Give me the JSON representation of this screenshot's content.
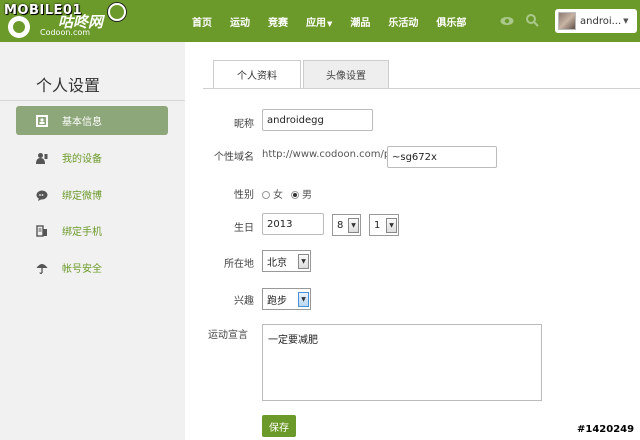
{
  "header": {
    "watermark_brand": "MOBILE01",
    "brand_cn": "咕咚网",
    "brand_en": "Codoon.com",
    "nav": [
      {
        "label": "首页"
      },
      {
        "label": "运动"
      },
      {
        "label": "竞赛"
      },
      {
        "label": "应用",
        "has_caret": true
      },
      {
        "label": "潮品"
      },
      {
        "label": "乐活动"
      },
      {
        "label": "俱乐部"
      }
    ],
    "user_name": "androi...",
    "accent_color": "#6c9a2a"
  },
  "sidebar": {
    "title": "个人设置",
    "items": [
      {
        "label": "基本信息",
        "icon": "id-card-icon",
        "active": true
      },
      {
        "label": "我的设备",
        "icon": "user-device-icon",
        "active": false
      },
      {
        "label": "绑定微博",
        "icon": "weibo-icon",
        "active": false
      },
      {
        "label": "绑定手机",
        "icon": "phone-icon",
        "active": false
      },
      {
        "label": "帐号安全",
        "icon": "umbrella-icon",
        "active": false
      }
    ]
  },
  "tabs": [
    {
      "label": "个人资料",
      "active": true
    },
    {
      "label": "头像设置",
      "active": false
    }
  ],
  "form": {
    "nickname_label": "昵称",
    "nickname_value": "androidegg",
    "domain_label": "个性域名",
    "domain_prefix": "http://www.codoon.com/p/",
    "domain_value": "~sg672x",
    "gender_label": "性别",
    "gender_female": "女",
    "gender_male": "男",
    "gender_selected": "男",
    "birthday_label": "生日",
    "birth_year": "2013",
    "birth_month": "8",
    "birth_day": "1",
    "location_label": "所在地",
    "location_value": "北京",
    "interest_label": "兴趣",
    "interest_value": "跑步",
    "motto_label": "运动宣言",
    "motto_value": "一定要减肥",
    "save_label": "保存"
  },
  "watermark": "#1420249"
}
